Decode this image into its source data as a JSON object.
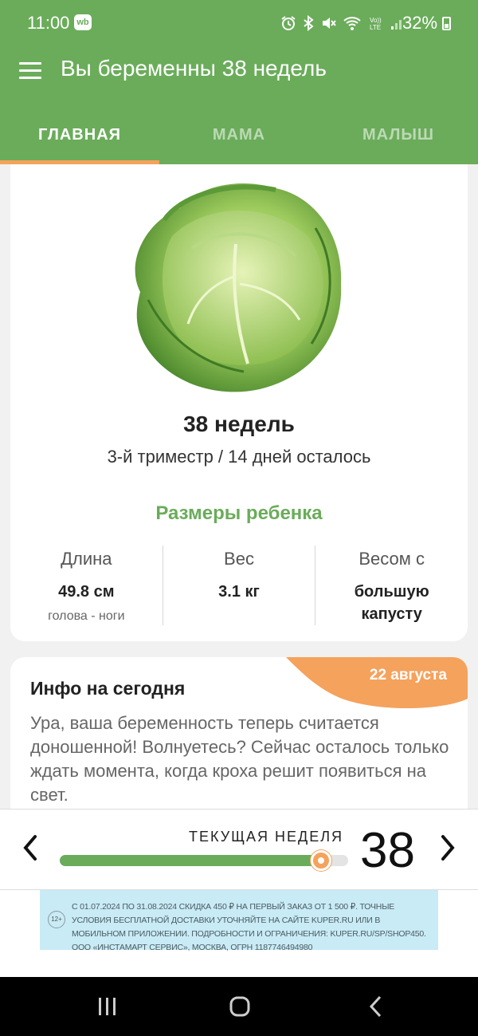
{
  "status_bar": {
    "time": "11:00",
    "wb_badge": "wb",
    "battery": "32%"
  },
  "app_bar": {
    "title": "Вы беременны 38 недель"
  },
  "tabs": [
    {
      "label": "ГЛАВНАЯ",
      "active": true
    },
    {
      "label": "МАМА",
      "active": false
    },
    {
      "label": "МАЛЫШ",
      "active": false
    }
  ],
  "week_card": {
    "image": "cabbage",
    "title": "38 недель",
    "subtitle": "3-й триместр / 14 дней осталось",
    "sizes_heading": "Размеры ребенка",
    "metrics": [
      {
        "label": "Длина",
        "value": "49.8 см",
        "note": "голова - ноги"
      },
      {
        "label": "Вес",
        "value": "3.1 кг",
        "note": ""
      },
      {
        "label": "Весом с",
        "value": "большую капусту",
        "note": ""
      }
    ]
  },
  "info_card": {
    "date": "22 августа",
    "title": "Инфо на сегодня",
    "text": "Ура, ваша беременность теперь считается доношенной! Волнуетесь? Сейчас осталось только ждать момента, когда кроха решит появиться на свет."
  },
  "week_selector": {
    "label": "ТЕКУЩАЯ НЕДЕЛЯ",
    "number": "38",
    "progress": 0.905
  },
  "ad": {
    "age_rating": "12+",
    "text": "С 01.07.2024 по 31.08.2024 скидка 450 ₽ на первый заказ от 1 500 ₽. Точные условия бесплатной доставки уточняйте на сайте kuper.ru или в мобильном приложении. Подробности и ограничения: kuper.ru/sp/shop450. ООО «Инстамарт Сервис», Москва, ОГРН 1187746494980"
  },
  "colors": {
    "brand_green": "#6aac5a",
    "accent_orange": "#f5a25d"
  }
}
